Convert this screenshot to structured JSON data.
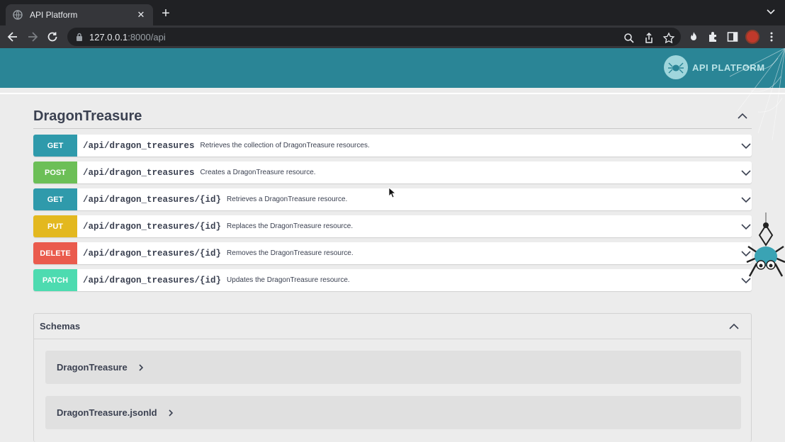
{
  "browser": {
    "tab_title": "API Platform",
    "tab_close": "✕",
    "new_tab": "+",
    "url_host": "127.0.0.1",
    "url_path": ":8000/api"
  },
  "header": {
    "brand_text": "API PLATFORM",
    "background": "#2a8596"
  },
  "section": {
    "title": "DragonTreasure",
    "operations": [
      {
        "method": "GET",
        "color": "#2f9aab",
        "path": "/api/dragon_treasures",
        "description": "Retrieves the collection of DragonTreasure resources."
      },
      {
        "method": "POST",
        "color": "#6cbf57",
        "path": "/api/dragon_treasures",
        "description": "Creates a DragonTreasure resource."
      },
      {
        "method": "GET",
        "color": "#2f9aab",
        "path": "/api/dragon_treasures/{id}",
        "description": "Retrieves a DragonTreasure resource."
      },
      {
        "method": "PUT",
        "color": "#e3b81f",
        "path": "/api/dragon_treasures/{id}",
        "description": "Replaces the DragonTreasure resource."
      },
      {
        "method": "DELETE",
        "color": "#ea5b4d",
        "path": "/api/dragon_treasures/{id}",
        "description": "Removes the DragonTreasure resource."
      },
      {
        "method": "PATCH",
        "color": "#4ddbb0",
        "path": "/api/dragon_treasures/{id}",
        "description": "Updates the DragonTreasure resource."
      }
    ]
  },
  "schemas": {
    "title": "Schemas",
    "models": [
      {
        "name": "DragonTreasure"
      },
      {
        "name": "DragonTreasure.jsonld"
      }
    ]
  }
}
